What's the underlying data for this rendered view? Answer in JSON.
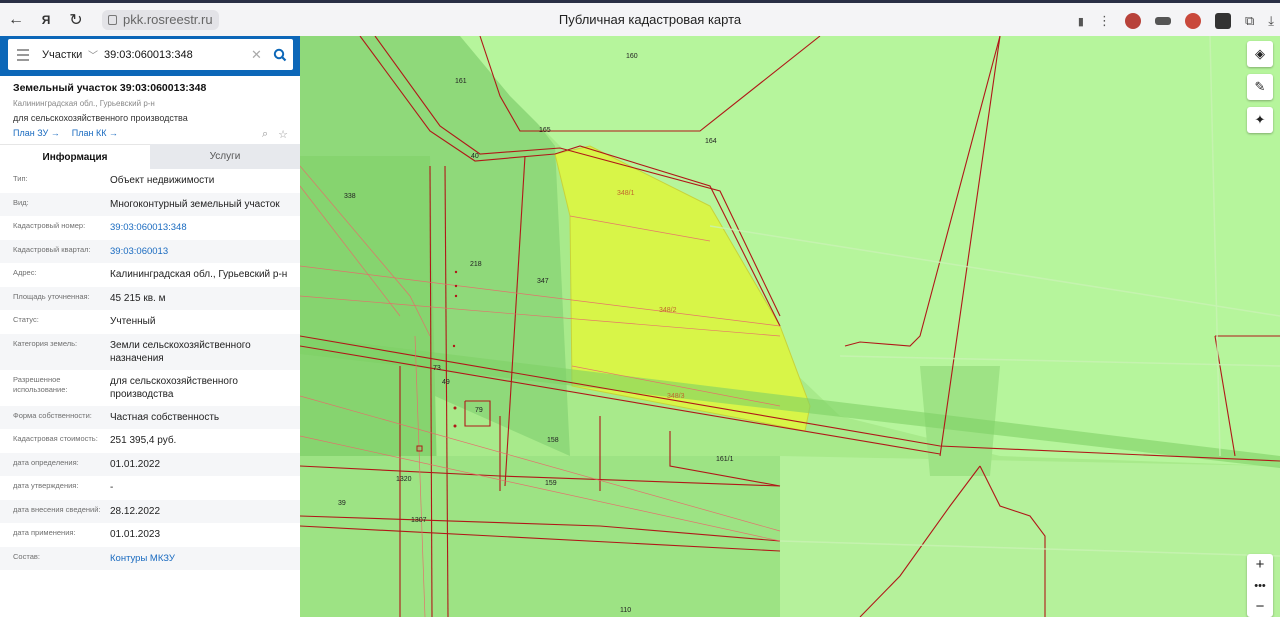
{
  "browser": {
    "url": "pkk.rosreestr.ru",
    "title": "Публичная кадастровая карта"
  },
  "search": {
    "type": "Участки",
    "query": "39:03:060013:348"
  },
  "object": {
    "title": "Земельный участок 39:03:060013:348",
    "subtitle": "Калининградская обл., Гурьевский р-н",
    "use": "для сельскохозяйственного производства",
    "plan_zu": "План ЗУ →",
    "plan_kk": "План КК →"
  },
  "tabs": {
    "info": "Информация",
    "services": "Услуги"
  },
  "rows": [
    {
      "label": "Тип:",
      "value": "Объект недвижимости"
    },
    {
      "label": "Вид:",
      "value": "Многоконтурный земельный участок"
    },
    {
      "label": "Кадастровый номер:",
      "value": "39:03:060013:348"
    },
    {
      "label": "Кадастровый квартал:",
      "value": "39:03:060013"
    },
    {
      "label": "Адрес:",
      "value": "Калининградская обл., Гурьевский р-н"
    },
    {
      "label": "Площадь уточненная:",
      "value": "45 215 кв. м"
    },
    {
      "label": "Статус:",
      "value": "Учтенный"
    },
    {
      "label": "Категория земель:",
      "value": "Земли сельскохозяйственного назначения"
    },
    {
      "label": "Разрешенное использование:",
      "value": "для сельскохозяйственного производства"
    },
    {
      "label": "Форма собственности:",
      "value": "Частная собственность"
    },
    {
      "label": "Кадастровая стоимость:",
      "value": "251 395,4 руб."
    },
    {
      "label": "дата определения:",
      "value": "01.01.2022"
    },
    {
      "label": "дата утверждения:",
      "value": "-"
    },
    {
      "label": "дата внесения сведений:",
      "value": "28.12.2022"
    },
    {
      "label": "дата применения:",
      "value": "01.01.2023"
    },
    {
      "label": "Состав:",
      "value": "Контуры МКЗУ"
    }
  ],
  "map_labels": {
    "l160": "160",
    "l161": "161",
    "l165": "165",
    "l164": "164",
    "l40": "40",
    "l338": "338",
    "l218": "218",
    "l347": "347",
    "l348_1": "348/1",
    "l348_2": "348/2",
    "l348_3": "348/3",
    "l73": "73",
    "l49": "49",
    "l79": "79",
    "l158": "158",
    "l161_1": "161/1",
    "l159": "159",
    "l1320": "1320",
    "l39": "39",
    "l1307": "1307",
    "l110": "110"
  },
  "colors": {
    "accent": "#0c67b8",
    "link": "#1a6bc0",
    "parcel_highlight": "#d8f548",
    "boundary": "#b01818"
  }
}
